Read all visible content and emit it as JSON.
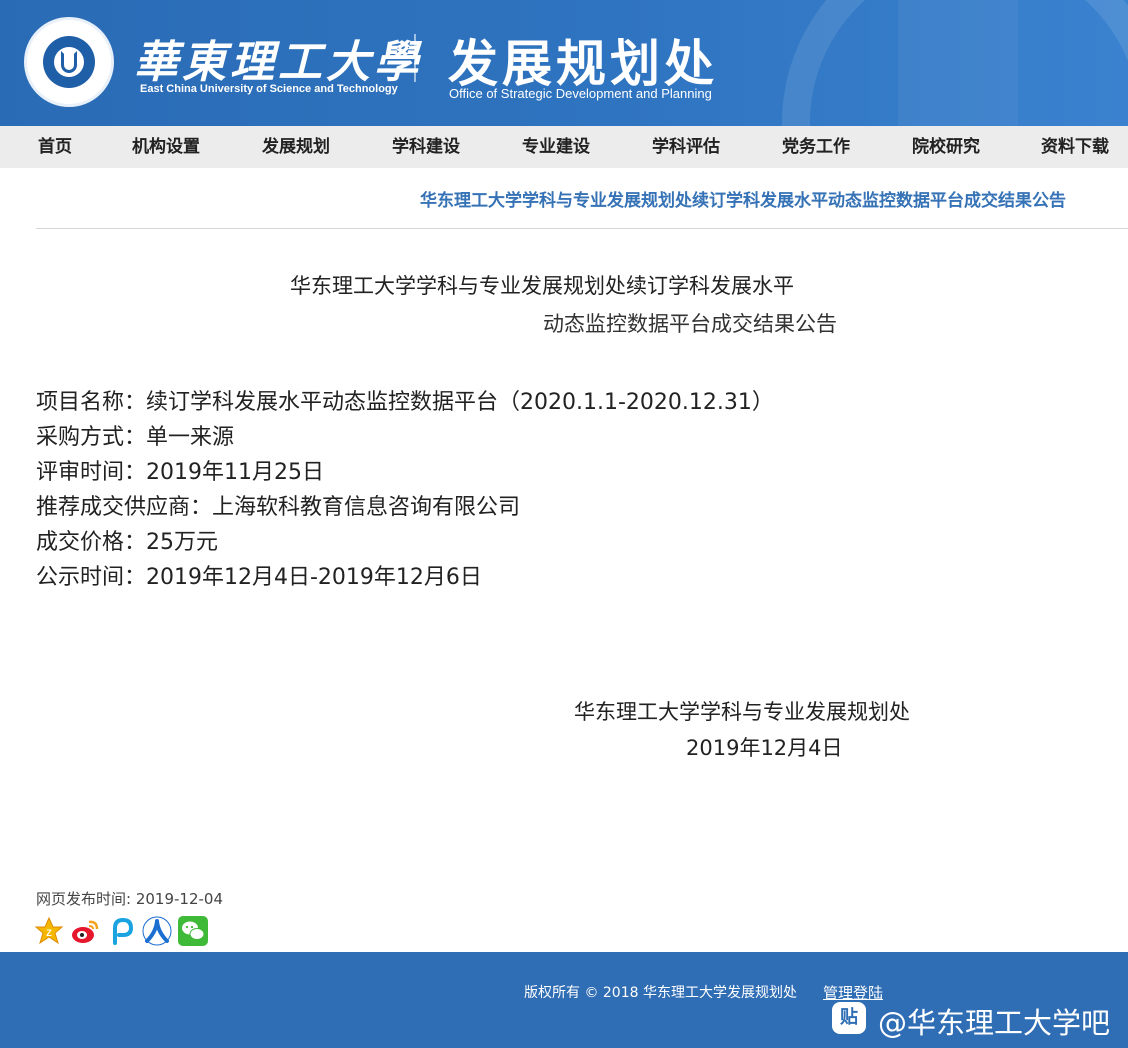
{
  "header": {
    "university_cn": "華東理工大學",
    "university_en": "East China University of Science and Technology",
    "dept_cn": "发展规划处",
    "dept_en": "Office of Strategic Development and Planning"
  },
  "nav": [
    {
      "label": "首页"
    },
    {
      "label": "机构设置"
    },
    {
      "label": "发展规划"
    },
    {
      "label": "学科建设"
    },
    {
      "label": "专业建设"
    },
    {
      "label": "学科评估"
    },
    {
      "label": "党务工作"
    },
    {
      "label": "院校研究"
    },
    {
      "label": "资料下载"
    }
  ],
  "article": {
    "heading": "华东理工大学学科与专业发展规划处续订学科发展水平动态监控数据平台成交结果公告",
    "title_line1": "华东理工大学学科与专业发展规划处续订学科发展水平",
    "title_line2": "动态监控数据平台成交结果公告",
    "fields": [
      {
        "label": "项目名称：",
        "value": "续订学科发展水平动态监控数据平台（2020.1.1-2020.12.31）"
      },
      {
        "label": "采购方式：",
        "value": "单一来源"
      },
      {
        "label": "评审时间：",
        "value": "2019年11月25日"
      },
      {
        "label": "推荐成交供应商：",
        "value": "上海软科教育信息咨询有限公司"
      },
      {
        "label": "成交价格：",
        "value": "25万元"
      },
      {
        "label": "公示时间：",
        "value": "2019年12月4日-2019年12月6日"
      }
    ],
    "signature_org": "华东理工大学学科与专业发展规划处",
    "signature_date": "2019年12月4日",
    "publish_time": "网页发布时间: 2019-12-04"
  },
  "share_icons": [
    "qzone-icon",
    "weibo-icon",
    "pengyou-icon",
    "renren-icon",
    "wechat-icon"
  ],
  "footer": {
    "copyright": "版权所有 © 2018 华东理工大学发展规划处",
    "admin_link": "管理登陆",
    "watermark_badge": "贴",
    "watermark": "@华东理工大学吧"
  },
  "colors": {
    "brand_blue": "#2f6db4",
    "link_blue": "#3572b6",
    "nav_bg": "#ececec"
  }
}
